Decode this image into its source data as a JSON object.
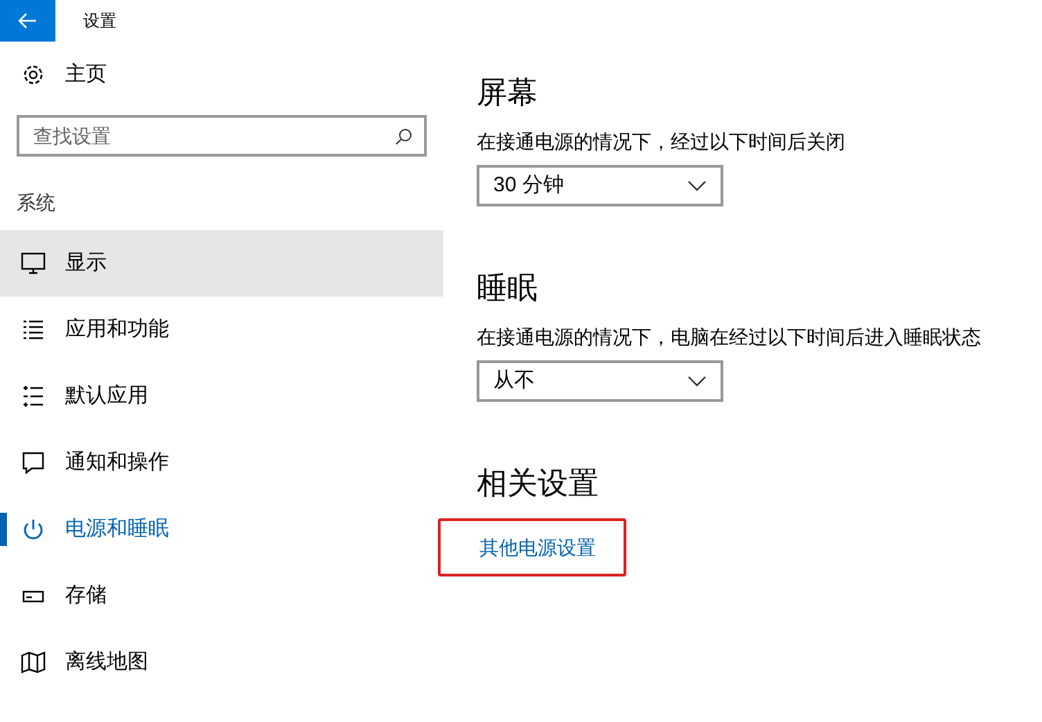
{
  "window": {
    "title": "设置"
  },
  "sidebar": {
    "home": "主页",
    "search": {
      "placeholder": "查找设置"
    },
    "section": "系统",
    "items": [
      {
        "label": "显示",
        "kind": "monitor",
        "selected": true
      },
      {
        "label": "应用和功能",
        "kind": "list",
        "selected": false
      },
      {
        "label": "默认应用",
        "kind": "defaults",
        "selected": false
      },
      {
        "label": "通知和操作",
        "kind": "message",
        "selected": false
      },
      {
        "label": "电源和睡眠",
        "kind": "power",
        "selected": false,
        "active": true
      },
      {
        "label": "存储",
        "kind": "storage",
        "selected": false
      },
      {
        "label": "离线地图",
        "kind": "map",
        "selected": false
      }
    ]
  },
  "content": {
    "sections": [
      {
        "heading": "屏幕",
        "description": "在接通电源的情况下，经过以下时间后关闭",
        "dropdown": "30 分钟"
      },
      {
        "heading": "睡眠",
        "description": "在接通电源的情况下，电脑在经过以下时间后进入睡眠状态",
        "dropdown": "从不"
      }
    ],
    "related": {
      "heading": "相关设置",
      "link": "其他电源设置",
      "highlighted": true
    }
  }
}
